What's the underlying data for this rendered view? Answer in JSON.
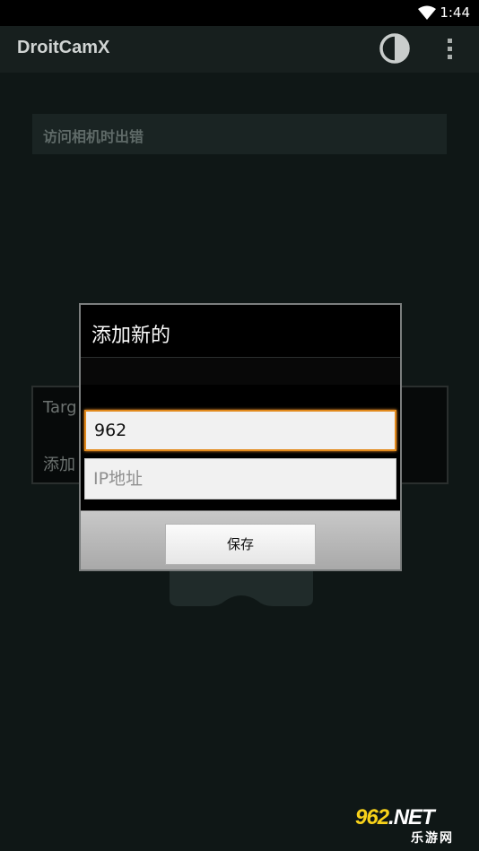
{
  "status_bar": {
    "time": "1:44"
  },
  "app": {
    "title": "DroitCamX"
  },
  "icons": {
    "contrast": "contrast-icon",
    "overflow": "overflow-menu-icon",
    "wifi": "wifi-icon"
  },
  "background": {
    "error_text": "访问相机时出错",
    "card_line1": "Targ",
    "card_line2": "添加"
  },
  "dialog": {
    "title": "添加新的",
    "name_value": "962",
    "ip_placeholder": "IP地址",
    "save_label": "保存"
  },
  "watermark": {
    "brand": "962",
    "tld": ".NET",
    "subtitle": "乐游网"
  },
  "colors": {
    "accent": "#e28a1c",
    "background": "#0f1716",
    "actionbar": "#171f1e"
  }
}
